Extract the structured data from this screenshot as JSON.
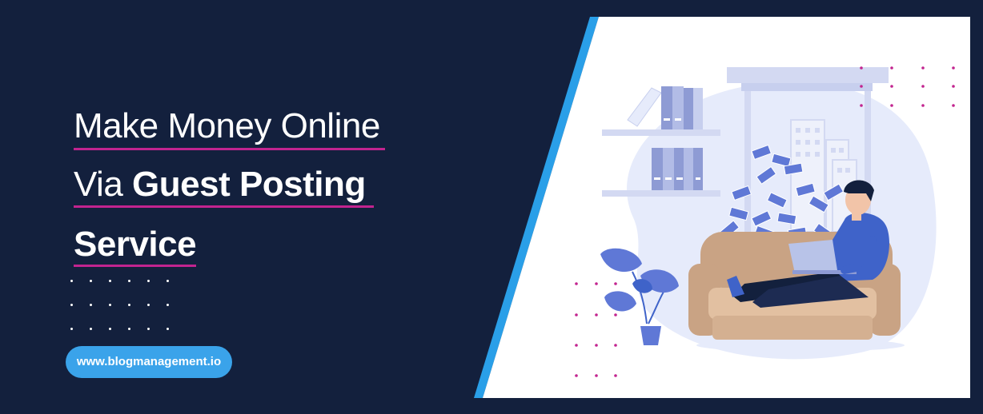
{
  "headline": {
    "line1": "Make Money Online",
    "line2_regular": "Via ",
    "line2_bold": "Guest Posting",
    "line3_bold": "Service"
  },
  "website": "www.blogmanagement.io",
  "colors": {
    "background": "#13203d",
    "accent_blue": "#3aa3ea",
    "underline_magenta": "#c2248f",
    "panel": "#ffffff"
  },
  "icons": [
    "decorative-dot-grid",
    "bookshelf",
    "window-cityscape",
    "flying-money",
    "sofa",
    "person-with-laptop",
    "potted-plant"
  ]
}
